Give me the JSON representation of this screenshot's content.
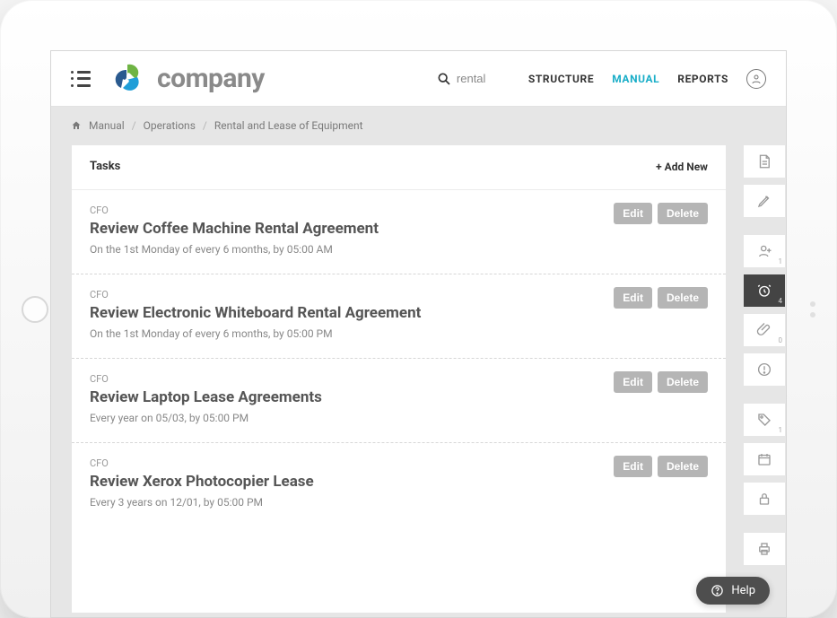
{
  "header": {
    "brand_text": "company",
    "search_value": "rental",
    "nav": {
      "structure": "STRUCTURE",
      "manual": "MANUAL",
      "reports": "REPORTS"
    }
  },
  "breadcrumbs": {
    "root": "Manual",
    "level1": "Operations",
    "level2": "Rental and Lease of Equipment"
  },
  "panel": {
    "title": "Tasks",
    "add_new_label": "+ Add New",
    "edit_label": "Edit",
    "delete_label": "Delete"
  },
  "tasks": [
    {
      "role": "CFO",
      "title": "Review Coffee Machine Rental Agreement",
      "schedule": "On the 1st Monday of every 6 months, by 05:00 AM"
    },
    {
      "role": "CFO",
      "title": "Review Electronic Whiteboard Rental Agreement",
      "schedule": "On the 1st Monday of every 6 months, by 05:00 PM"
    },
    {
      "role": "CFO",
      "title": "Review Laptop Lease Agreements",
      "schedule": "Every year on 05/03, by 05:00 PM"
    },
    {
      "role": "CFO",
      "title": "Review Xerox Photocopier Lease",
      "schedule": "Every 3 years on 12/01, by 05:00 PM"
    }
  ],
  "rail_badges": {
    "person": "1",
    "clock": "4",
    "attach": "0",
    "tag": "1"
  },
  "help": {
    "label": "Help"
  }
}
